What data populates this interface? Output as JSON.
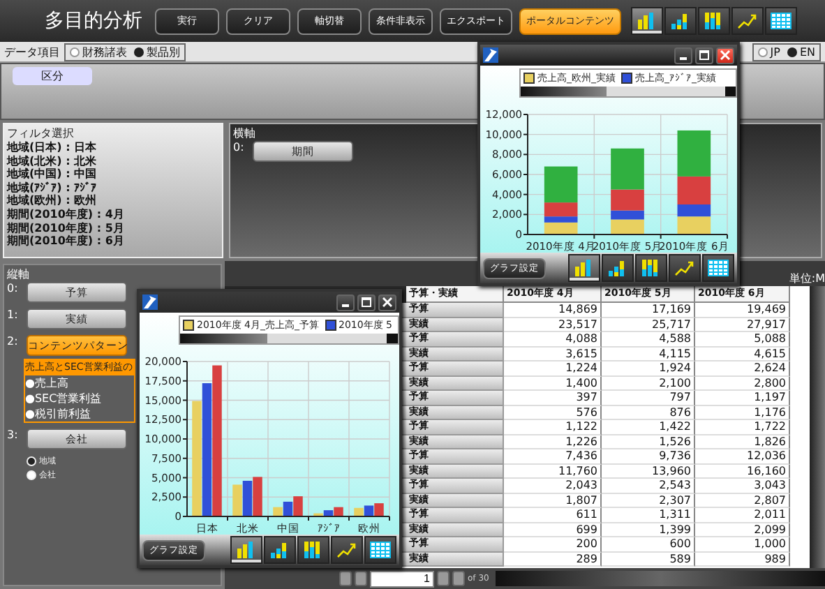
{
  "header": {
    "title": "多目的分析",
    "buttons": [
      {
        "label": "実行",
        "highlighted": false
      },
      {
        "label": "クリア",
        "highlighted": false
      },
      {
        "label": "軸切替",
        "highlighted": false
      },
      {
        "label": "条件非表示",
        "highlighted": false
      },
      {
        "label": "エクスポート",
        "highlighted": false
      },
      {
        "label": "ポータルコンテンツ",
        "highlighted": true
      }
    ],
    "chart_types": [
      {
        "kind": "bar",
        "selected": true
      },
      {
        "kind": "stacked",
        "selected": false
      },
      {
        "kind": "full",
        "selected": false
      },
      {
        "kind": "line",
        "selected": false
      },
      {
        "kind": "table",
        "selected": false
      }
    ]
  },
  "data_items": {
    "label": "データ項目",
    "options": [
      {
        "label": "財務諸表",
        "selected": false
      },
      {
        "label": "製品別",
        "selected": true
      }
    ]
  },
  "language": [
    {
      "label": "JP",
      "selected": false
    },
    {
      "label": "EN",
      "selected": true
    }
  ],
  "row_area": {
    "chips": [
      "区分"
    ]
  },
  "filter": {
    "title": "フィルタ選択",
    "lines": [
      "地域(日本) : 日本",
      "地域(北米) : 北米",
      "地域(中国) : 中国",
      "地域(ｱｼﾞｱ) : ｱｼﾞｱ",
      "地域(欧州) : 欧州",
      "期間(2010年度) : 4月",
      "期間(2010年度) : 5月",
      "期間(2010年度) : 6月"
    ]
  },
  "horizontal_axis": {
    "title": "横軸",
    "items": [
      {
        "index": "0:",
        "label": "期間"
      }
    ]
  },
  "vertical_axis": {
    "title": "縦軸",
    "items": [
      {
        "index": "0:",
        "label": "予算",
        "selected": false
      },
      {
        "index": "1:",
        "label": "実績",
        "selected": false
      },
      {
        "index": "2:",
        "label": "コンテンツパターン",
        "selected": true
      },
      {
        "index": "3:",
        "label": "会社",
        "selected": false
      }
    ],
    "dropdown": {
      "header": "売上高とSEC営業利益の",
      "options": [
        "●売上高",
        "●SEC営業利益",
        "●税引前利益"
      ]
    },
    "radios": [
      {
        "label": "地域",
        "selected": true
      },
      {
        "label": "会社",
        "selected": false
      }
    ]
  },
  "table": {
    "unit": "単位:M",
    "columns": [
      "予算・実績",
      "2010年度 4月",
      "2010年度 5月",
      "2010年度 6月"
    ],
    "rows": [
      {
        "type": "予算",
        "values": [
          "14,869",
          "17,169",
          "19,469"
        ]
      },
      {
        "type": "実績",
        "values": [
          "23,517",
          "25,717",
          "27,917"
        ]
      },
      {
        "type": "予算",
        "values": [
          "4,088",
          "4,588",
          "5,088"
        ]
      },
      {
        "type": "実績",
        "values": [
          "3,615",
          "4,115",
          "4,615"
        ]
      },
      {
        "type": "予算",
        "values": [
          "1,224",
          "1,924",
          "2,624"
        ]
      },
      {
        "type": "実績",
        "values": [
          "1,400",
          "2,100",
          "2,800"
        ]
      },
      {
        "type": "予算",
        "values": [
          "397",
          "797",
          "1,197"
        ]
      },
      {
        "type": "実績",
        "values": [
          "576",
          "876",
          "1,176"
        ]
      },
      {
        "type": "予算",
        "values": [
          "1,122",
          "1,422",
          "1,722"
        ]
      },
      {
        "type": "実績",
        "values": [
          "1,226",
          "1,526",
          "1,826"
        ]
      },
      {
        "type": "予算",
        "values": [
          "7,436",
          "9,736",
          "12,036"
        ]
      },
      {
        "type": "実績",
        "values": [
          "11,760",
          "13,960",
          "16,160"
        ]
      },
      {
        "type": "予算",
        "values": [
          "2,043",
          "2,543",
          "3,043"
        ]
      },
      {
        "type": "実績",
        "values": [
          "1,807",
          "2,307",
          "2,807"
        ]
      },
      {
        "type": "予算",
        "values": [
          "611",
          "1,311",
          "2,011"
        ]
      },
      {
        "type": "実績",
        "values": [
          "699",
          "1,399",
          "2,099"
        ]
      },
      {
        "type": "予算",
        "values": [
          "200",
          "600",
          "1,000"
        ]
      },
      {
        "type": "実績",
        "values": [
          "289",
          "589",
          "989"
        ]
      }
    ]
  },
  "pager": {
    "page": "1",
    "total": "of 30"
  },
  "chart_windows": [
    {
      "active": true,
      "settings_label": "グラフ設定",
      "chart_types": [
        {
          "kind": "bar",
          "selected": true
        },
        {
          "kind": "stacked",
          "selected": false
        },
        {
          "kind": "full",
          "selected": false
        },
        {
          "kind": "line",
          "selected": false
        },
        {
          "kind": "table",
          "selected": false
        }
      ],
      "chart_data": {
        "type": "bar",
        "stacked": true,
        "grid": true,
        "categories": [
          "2010年度 4月",
          "2010年度 5月",
          "2010年度 6月"
        ],
        "ylim": [
          0,
          12000
        ],
        "yticks": [
          {
            "value": 0,
            "label": "0"
          },
          {
            "value": 2000,
            "label": "2,000"
          },
          {
            "value": 4000,
            "label": "4,000"
          },
          {
            "value": 6000,
            "label": "6,000"
          },
          {
            "value": 8000,
            "label": "8,000"
          },
          {
            "value": 10000,
            "label": "10,000"
          },
          {
            "value": 12000,
            "label": "12,000"
          }
        ],
        "series": [
          {
            "name": "売上高_欧州_実績",
            "color": "#e8d060",
            "values": [
              1200,
              1500,
              1800
            ]
          },
          {
            "name": "売上高_ｱｼﾞｱ_実績",
            "color": "#3050d8",
            "values": [
              600,
              900,
              1200
            ]
          },
          {
            "color": "#d84040",
            "values": [
              1400,
              2100,
              2800
            ]
          },
          {
            "color": "#30b040",
            "values": [
              3600,
              4100,
              4600
            ]
          }
        ]
      }
    },
    {
      "active": false,
      "settings_label": "グラフ設定",
      "chart_types": [
        {
          "kind": "bar",
          "selected": true
        },
        {
          "kind": "stacked",
          "selected": false
        },
        {
          "kind": "full",
          "selected": false
        },
        {
          "kind": "line",
          "selected": false
        },
        {
          "kind": "table",
          "selected": false
        }
      ],
      "chart_data": {
        "type": "bar",
        "stacked": false,
        "grid": true,
        "categories": [
          "日本",
          "北米",
          "中国",
          "ｱｼﾞｱ",
          "欧州"
        ],
        "ylim": [
          0,
          20000
        ],
        "yticks": [
          {
            "value": 0,
            "label": "0"
          },
          {
            "value": 2500,
            "label": "2,500"
          },
          {
            "value": 5000,
            "label": "5,000"
          },
          {
            "value": 7500,
            "label": "7,500"
          },
          {
            "value": 10000,
            "label": "10,000"
          },
          {
            "value": 12500,
            "label": "12,500"
          },
          {
            "value": 15000,
            "label": "15,000"
          },
          {
            "value": 17500,
            "label": "17,500"
          },
          {
            "value": 20000,
            "label": "20,000"
          }
        ],
        "series": [
          {
            "name": "2010年度 4月_売上高_予算",
            "color": "#e8d060",
            "values": [
              14900,
              4100,
              1200,
              400,
              1100
            ]
          },
          {
            "name": "2010年度 5",
            "color": "#3050d8",
            "values": [
              17200,
              4600,
              1900,
              800,
              1400
            ]
          },
          {
            "color": "#d84040",
            "values": [
              19500,
              5100,
              2600,
              1200,
              1700
            ]
          }
        ]
      }
    }
  ]
}
